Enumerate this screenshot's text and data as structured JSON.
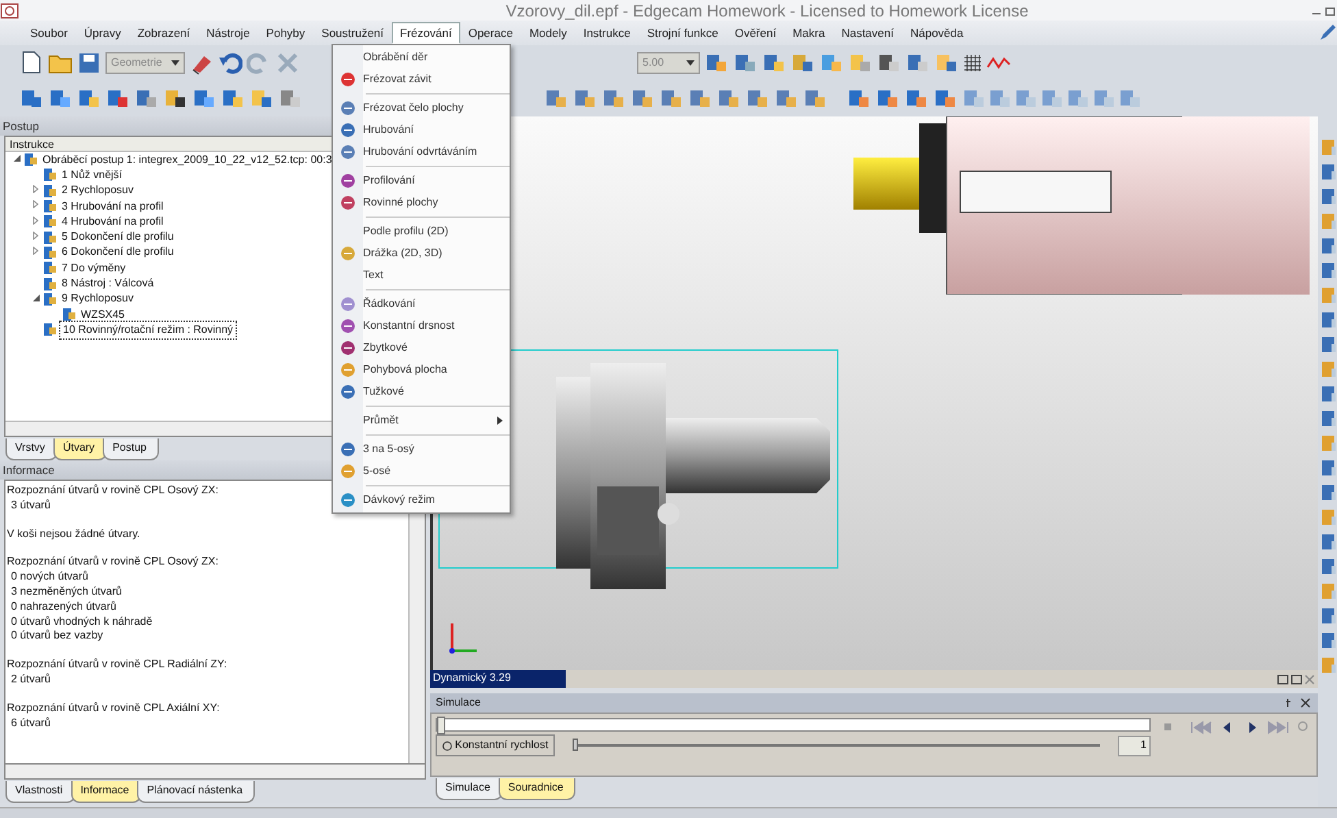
{
  "window": {
    "title": "Vzorovy_dil.epf - Edgecam Homework - Licensed to Homework License"
  },
  "menu": [
    {
      "label": "Soubor",
      "selected": false
    },
    {
      "label": "Úpravy",
      "selected": false
    },
    {
      "label": "Zobrazení",
      "selected": false
    },
    {
      "label": "Nástroje",
      "selected": false
    },
    {
      "label": "Pohyby",
      "selected": false
    },
    {
      "label": "Soustružení",
      "selected": false
    },
    {
      "label": "Frézování",
      "selected": true
    },
    {
      "label": "Operace",
      "selected": false
    },
    {
      "label": "Modely",
      "selected": false
    },
    {
      "label": "Instrukce",
      "selected": false
    },
    {
      "label": "Strojní funkce",
      "selected": false
    },
    {
      "label": "Ověření",
      "selected": false
    },
    {
      "label": "Makra",
      "selected": false
    },
    {
      "label": "Nastavení",
      "selected": false
    },
    {
      "label": "Nápověda",
      "selected": false
    }
  ],
  "toolbar": {
    "layer_combo": "Geometrie",
    "value_combo": "5.00"
  },
  "dropdown": [
    {
      "kind": "item",
      "label": "Obrábění děr",
      "icon": false
    },
    {
      "kind": "item",
      "label": "Frézovat závit",
      "icon": true
    },
    {
      "kind": "separator"
    },
    {
      "kind": "item",
      "label": "Frézovat čelo plochy",
      "icon": true
    },
    {
      "kind": "item",
      "label": "Hrubování",
      "icon": true
    },
    {
      "kind": "item",
      "label": "Hrubování odvrtáváním",
      "icon": true
    },
    {
      "kind": "separator"
    },
    {
      "kind": "item",
      "label": "Profilování",
      "icon": true
    },
    {
      "kind": "item",
      "label": "Rovinné plochy",
      "icon": true
    },
    {
      "kind": "separator"
    },
    {
      "kind": "item",
      "label": "Podle profilu (2D)",
      "icon": false
    },
    {
      "kind": "item",
      "label": "Drážka (2D, 3D)",
      "icon": true
    },
    {
      "kind": "item",
      "label": "Text",
      "icon": false
    },
    {
      "kind": "separator"
    },
    {
      "kind": "item",
      "label": "Řádkování",
      "icon": true
    },
    {
      "kind": "item",
      "label": "Konstantní drsnost",
      "icon": true
    },
    {
      "kind": "item",
      "label": "Zbytkové",
      "icon": true
    },
    {
      "kind": "item",
      "label": "Pohybová plocha",
      "icon": true
    },
    {
      "kind": "item",
      "label": "Tužkové",
      "icon": true
    },
    {
      "kind": "separator"
    },
    {
      "kind": "submenu",
      "label": "Průmět",
      "icon": false
    },
    {
      "kind": "separator"
    },
    {
      "kind": "item",
      "label": "3 na 5-osý",
      "icon": true
    },
    {
      "kind": "item",
      "label": "5-osé",
      "icon": true
    },
    {
      "kind": "separator"
    },
    {
      "kind": "item",
      "label": "Dávkový režim",
      "icon": true
    }
  ],
  "postup": {
    "title": "Postup",
    "column": "Instrukce",
    "tree": [
      {
        "label": "Obráběcí postup 1: integrex_2009_10_22_v12_52.tcp: 00:3",
        "expanded": true,
        "selected": false,
        "children": [
          {
            "label": "1 Nůž vnější",
            "selected": false
          },
          {
            "label": "2 Rychloposuv",
            "expanded": false,
            "selected": false
          },
          {
            "label": "3 Hrubování na profil",
            "expanded": false,
            "selected": false
          },
          {
            "label": "4 Hrubování na profil",
            "expanded": false,
            "selected": false
          },
          {
            "label": "5 Dokončení dle profilu",
            "expanded": false,
            "selected": false
          },
          {
            "label": "6 Dokončení dle profilu",
            "expanded": false,
            "selected": false
          },
          {
            "label": "7 Do výměny",
            "selected": false
          },
          {
            "label": "8 Nástroj : Válcová",
            "selected": false
          },
          {
            "label": "9 Rychloposuv",
            "expanded": true,
            "selected": false,
            "children": [
              {
                "label": "WZSX45",
                "selected": false
              }
            ]
          },
          {
            "label": "10 Rovinný/rotační režim : Rovinný",
            "selected": true
          }
        ]
      }
    ],
    "tabs": [
      {
        "label": "Vrstvy",
        "selected": false
      },
      {
        "label": "Útvary",
        "selected": true
      },
      {
        "label": "Postup",
        "selected": false
      }
    ]
  },
  "informace": {
    "title": "Informace",
    "blocks": [
      {
        "heading": "Rozpoznání útvarů v rovině CPL Osový ZX:",
        "lines": [
          "3 útvarů"
        ]
      },
      {
        "heading": "V koši nejsou žádné útvary."
      },
      {
        "heading": "Rozpoznání útvarů v rovině CPL Osový ZX:",
        "lines": [
          "0 nových útvarů",
          "3 nezměněných útvarů",
          "0 nahrazených útvarů",
          "0 útvarů vhodných k náhradě",
          "0 útvarů bez vazby"
        ]
      },
      {
        "heading": "Rozpoznání útvarů v rovině CPL Radiální ZY:",
        "lines": [
          "2 útvarů"
        ]
      },
      {
        "heading": "Rozpoznání útvarů v rovině CPL Axiální XY:",
        "lines": [
          "6 útvarů"
        ]
      }
    ],
    "tabs": [
      {
        "label": "Vlastnosti",
        "selected": false
      },
      {
        "label": "Informace",
        "selected": true
      },
      {
        "label": "Plánovací nástenka",
        "selected": false
      }
    ]
  },
  "viewport": {
    "status": "Dynamický 3.29"
  },
  "simulace": {
    "title": "Simulace",
    "position": {
      "level": 0
    },
    "mode_button": "Konstantní rychlost",
    "speed": {
      "level": 0
    },
    "speed_value": "1",
    "tabs": [
      {
        "label": "Simulace",
        "selected": false
      },
      {
        "label": "Souradnice",
        "selected": true
      }
    ]
  }
}
